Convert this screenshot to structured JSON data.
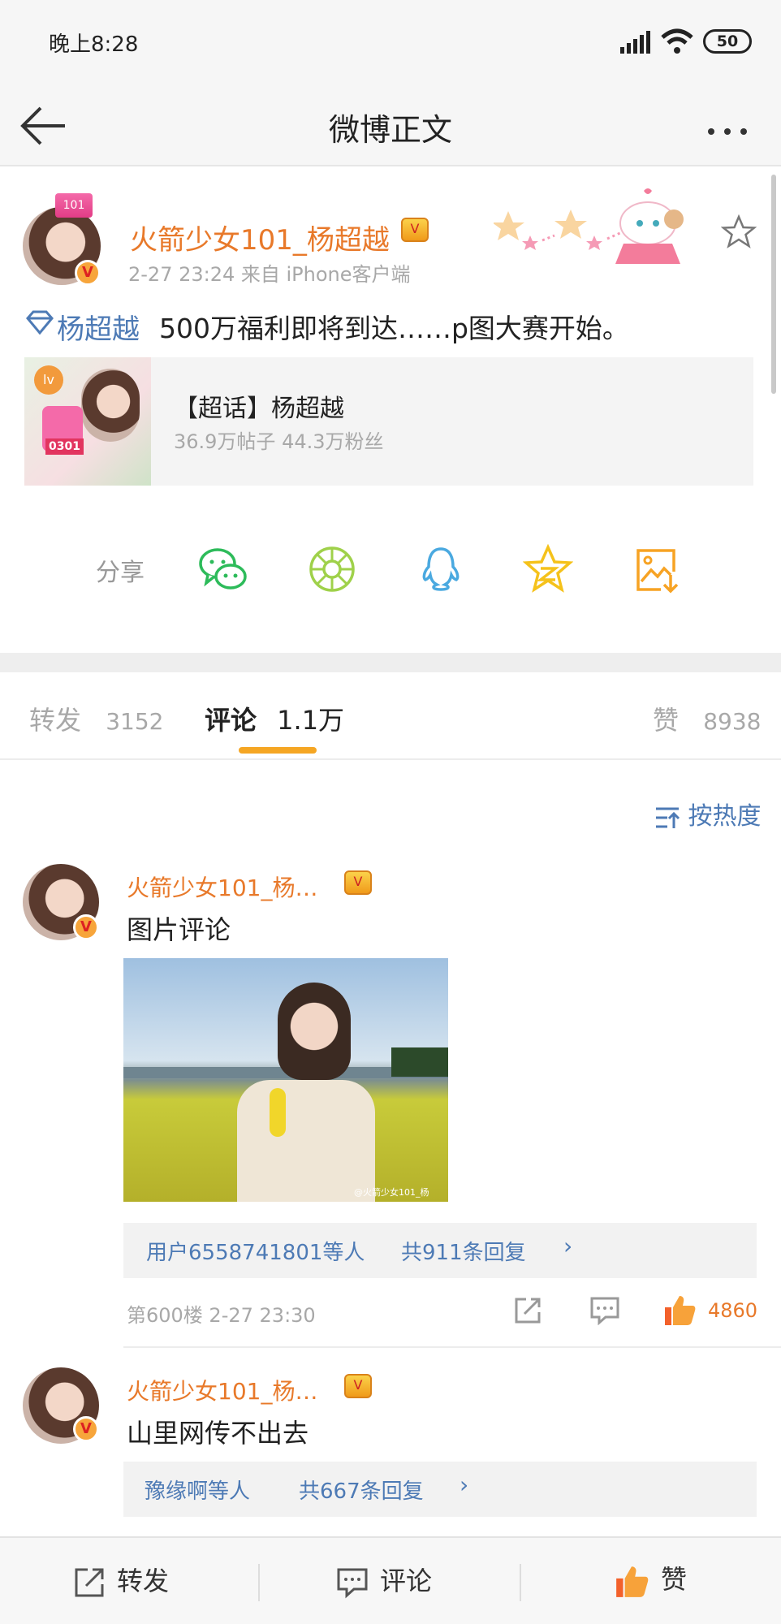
{
  "status_bar": {
    "time": "晚上8:28",
    "battery": "50"
  },
  "nav": {
    "title": "微博正文"
  },
  "post": {
    "author": "火箭少女101_杨超越",
    "meta": "2-27 23:24  来自 iPhone客户端",
    "topic_link": "杨超越",
    "text": "500万福利即将到达……p图大赛开始。",
    "topic_card": {
      "title": "【超话】杨超越",
      "stats": "36.9万帖子  44.3万粉丝",
      "badge": "0301"
    }
  },
  "share": {
    "label": "分享",
    "icons": [
      "wechat-icon",
      "moments-icon",
      "qq-icon",
      "qzone-icon",
      "save-image-icon"
    ]
  },
  "tabs": {
    "repost_label": "转发",
    "repost_count": "3152",
    "comment_label": "评论",
    "comment_count": "1.1万",
    "like_label": "赞",
    "like_count": "8938"
  },
  "sort": {
    "label": "按热度"
  },
  "comments": [
    {
      "author": "火箭少女101_杨…",
      "text": "图片评论",
      "watermark": "@火箭少女101_杨",
      "reply_users": "用户6558741801等人",
      "reply_count": "共911条回复",
      "floor_meta": "第600楼  2-27  23:30",
      "likes": "4860"
    },
    {
      "author": "火箭少女101_杨…",
      "text": "山里网传不出去",
      "reply_users": "豫缘啊等人",
      "reply_count": "共667条回复"
    }
  ],
  "bottom_bar": {
    "repost": "转发",
    "comment": "评论",
    "like": "赞"
  },
  "colors": {
    "accent_orange": "#e8792a",
    "link_blue": "#4d7ab5",
    "tab_underline": "#f5a623"
  }
}
